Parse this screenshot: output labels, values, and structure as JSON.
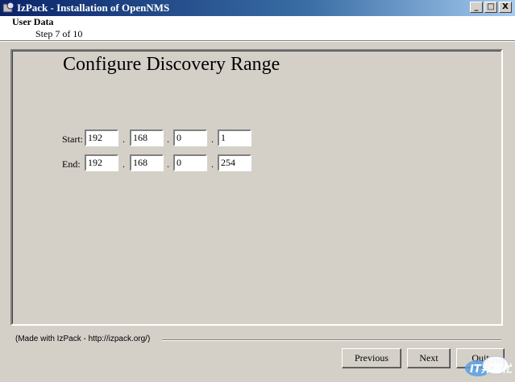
{
  "window": {
    "title": "IzPack - Installation of OpenNMS",
    "buttons": {
      "minimize": "_",
      "maximize": "□",
      "close": "X"
    }
  },
  "header": {
    "section_title": "User Data",
    "step": "Step 7 of 10"
  },
  "page": {
    "title": "Configure Discovery Range",
    "start": {
      "label": "Start:",
      "octets": [
        "192",
        "168",
        "0",
        "1"
      ]
    },
    "end": {
      "label": "End:",
      "octets": [
        "192",
        "168",
        "0",
        "254"
      ]
    },
    "separator": "."
  },
  "footer": {
    "made_with": "(Made with IzPack - http://izpack.org/)",
    "previous_label": "Previous",
    "next_label": "Next",
    "quit_label": "Quit"
  },
  "watermark": {
    "text": "IT邦幫忙"
  },
  "colors": {
    "titlebar_start": "#0a246a",
    "titlebar_end": "#a6caf0",
    "window_bg": "#d4d0c8"
  }
}
